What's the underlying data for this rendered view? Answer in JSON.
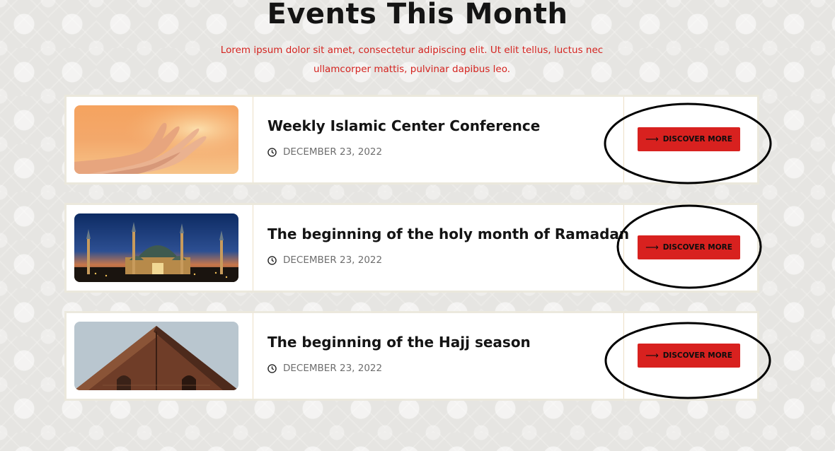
{
  "section": {
    "title": "Events This Month",
    "subtitle": "Lorem ipsum dolor sit amet, consectetur adipiscing elit. Ut elit tellus, luctus nec ullamcorper mattis, pulvinar dapibus leo."
  },
  "events": [
    {
      "title": "Weekly Islamic Center Conference",
      "date": "DECEMBER 23, 2022",
      "button_label": "DISCOVER MORE",
      "image": "praying-hands-sunset"
    },
    {
      "title": "The beginning of the holy month of Ramadan",
      "date": "DECEMBER 23, 2022",
      "button_label": "DISCOVER MORE",
      "image": "mosque-night"
    },
    {
      "title": "The beginning of the Hajj season",
      "date": "DECEMBER 23, 2022",
      "button_label": "DISCOVER MORE",
      "image": "building-roof"
    }
  ],
  "colors": {
    "accent": "#d8211f",
    "subtitle": "#d4231f",
    "heading": "#141414",
    "date_text": "#6e6e6e"
  },
  "icons": {
    "date": "clock-icon",
    "button": "arrow-right-icon"
  }
}
